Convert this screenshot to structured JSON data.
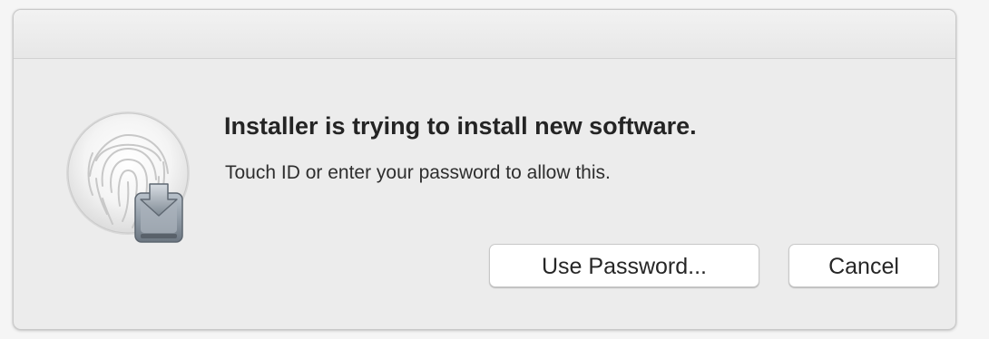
{
  "dialog": {
    "title": "Installer is trying to install new software.",
    "message": "Touch ID or enter your password to allow this.",
    "icon": "touch-id-fingerprint-icon",
    "badge_icon": "installer-download-disk-icon",
    "colors": {
      "panel": "#ececec",
      "button": "#ffffff",
      "text": "#242424"
    }
  },
  "buttons": {
    "use_password": "Use Password...",
    "cancel": "Cancel"
  }
}
